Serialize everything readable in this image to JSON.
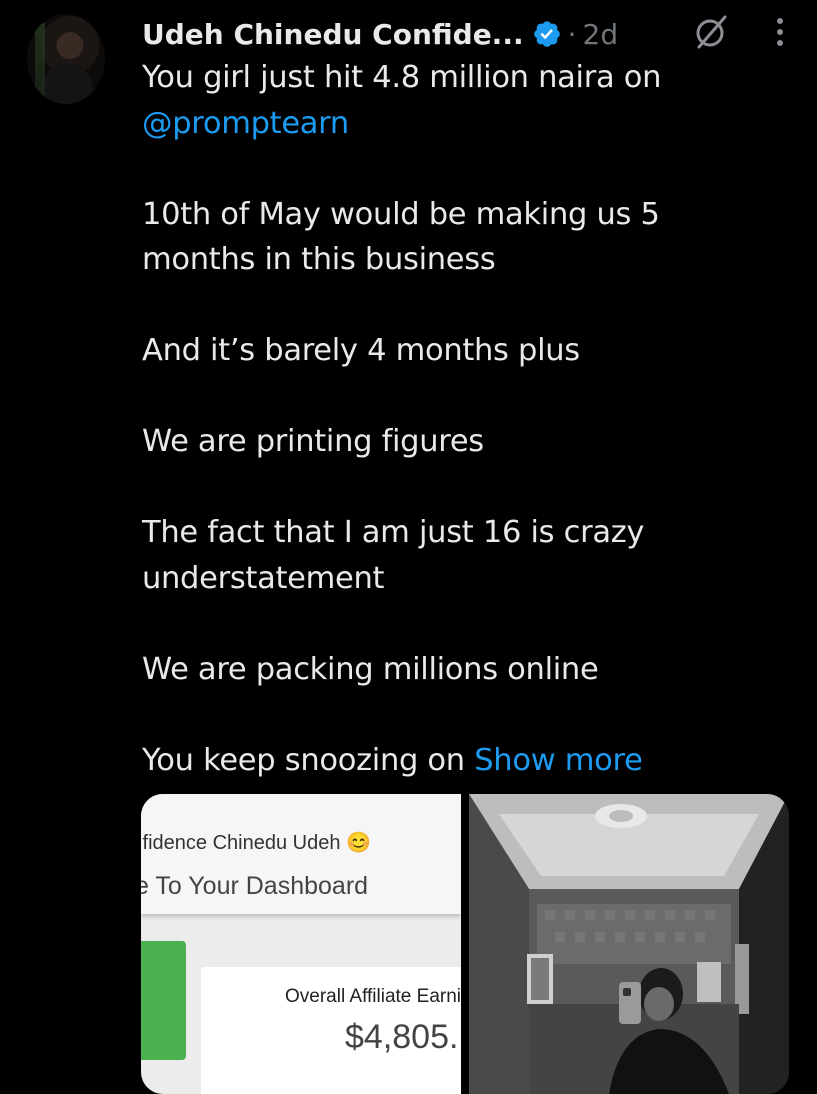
{
  "tweet": {
    "author_name": "Udeh Chinedu Confide...",
    "separator": "·",
    "time_ago": "2d",
    "mention": "@promptearn",
    "lines": {
      "l1": "You girl just hit 4.8 million naira on",
      "l3": "10th of May would be making us 5",
      "l4": "months in this business",
      "l5": "And it’s barely 4 months plus",
      "l6": "We are printing figures",
      "l7": "The fact that I am just 16 is crazy",
      "l8": "understatement",
      "l9": "We are packing millions online",
      "l10": "You keep snoozing on"
    },
    "show_more": "Show more"
  },
  "media": {
    "dashboard": {
      "user_name": "ıfidence Chinedu Udeh",
      "emoji": "😊",
      "welcome": "e To Your Dashboard",
      "earnings_label": "Overall Affiliate Earni",
      "earnings_value": "$4,805. "
    }
  },
  "icons": {
    "verified": "verified-badge-icon",
    "grok": "grok-icon",
    "more": "more-vertical-icon"
  },
  "colors": {
    "background": "#000000",
    "text": "#e7e9ea",
    "muted": "#71767b",
    "link": "#1d9bf0",
    "green": "#4caf50"
  }
}
